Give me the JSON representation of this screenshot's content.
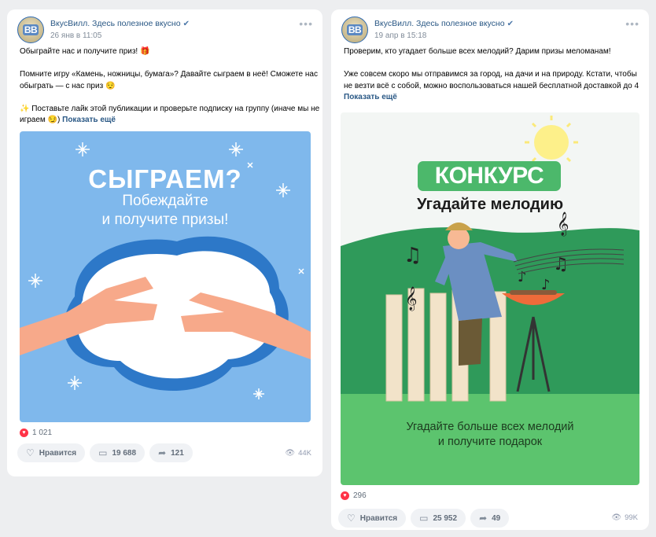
{
  "posts": [
    {
      "group_name": "ВкусВилл. Здесь полезное вкусно",
      "date": "26 янв в 11:05",
      "text_lines": [
        "Обыграйте нас и получите приз! 🎁",
        "",
        "Помните игру «Камень, ножницы, бумага»? Давайте сыграем в неё! Сможете нас",
        "обыграть — с нас приз 😌",
        "",
        "✨ Поставьте лайк этой публикации и проверьте подписку на группу (иначе мы не",
        "играем 😏)"
      ],
      "show_more": "Показать ещё",
      "image": {
        "headline": "СЫГРАЕМ?",
        "sub1": "Побеждайте",
        "sub2": "и получите призы!"
      },
      "likes": "1 021",
      "like_label": "Нравится",
      "comments": "19 688",
      "shares": "121",
      "views": "44K"
    },
    {
      "group_name": "ВкусВилл. Здесь полезное вкусно",
      "date": "19 апр в 15:18",
      "text_lines": [
        "Проверим, кто угадает больше всех мелодий? Дарим призы меломанам!",
        "",
        "Уже совсем скоро мы отправимся за город, на дачи и на природу. Кстати, чтобы",
        "не везти всё с собой, можно воспользоваться нашей бесплатной доставкой до 4"
      ],
      "show_more": "Показать ещё",
      "image": {
        "badge": "КОНКУРС",
        "title": "Угадайте мелодию",
        "bottom1": "Угадайте больше всех мелодий",
        "bottom2": "и получите подарок"
      },
      "likes": "296",
      "like_label": "Нравится",
      "comments": "25 952",
      "shares": "49",
      "views": "99K"
    }
  ],
  "avatar_text": "ВВ",
  "icons": {
    "heart": "heart-icon",
    "comment": "comment-icon",
    "share": "share-icon",
    "views": "eye-icon",
    "more": "more-icon",
    "verified": "verified-icon"
  },
  "colors": {
    "link": "#2a5885",
    "like_red": "#ff3347",
    "image1_bg": "#7fb8ec",
    "konkurs_green": "#4cb86b"
  }
}
